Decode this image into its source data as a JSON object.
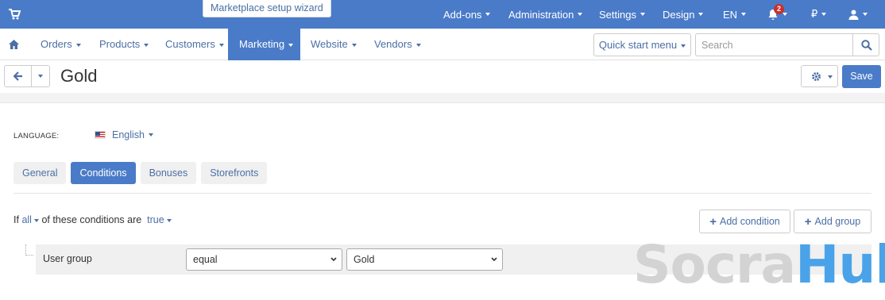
{
  "topbar": {
    "wizard_label": "Marketplace setup wizard",
    "items": {
      "addons": "Add-ons",
      "administration": "Administration",
      "settings": "Settings",
      "design": "Design",
      "language": "EN",
      "currency": "₽"
    },
    "notifications_count": "2"
  },
  "mainnav": {
    "orders": "Orders",
    "products": "Products",
    "customers": "Customers",
    "marketing": "Marketing",
    "website": "Website",
    "vendors": "Vendors",
    "quick_start": "Quick start menu",
    "search_placeholder": "Search"
  },
  "titlebar": {
    "title": "Gold",
    "save_label": "Save"
  },
  "content": {
    "language_label": "LANGUAGE:",
    "language_value": "English",
    "tabs": [
      "General",
      "Conditions",
      "Bonuses",
      "Storefronts"
    ],
    "active_tab": "Conditions",
    "condition_text": {
      "if": "If",
      "all": "all",
      "middle": "of these conditions are",
      "true": "true"
    },
    "add_condition": "Add condition",
    "add_group": "Add group",
    "condition_row": {
      "label": "User group",
      "operator": "equal",
      "value": "Gold"
    }
  },
  "watermark": {
    "part1": "Socra",
    "part2": "Hub"
  },
  "colors": {
    "accent": "#4a7bc8",
    "link": "#4a6fa5",
    "badge": "#c9302c"
  }
}
